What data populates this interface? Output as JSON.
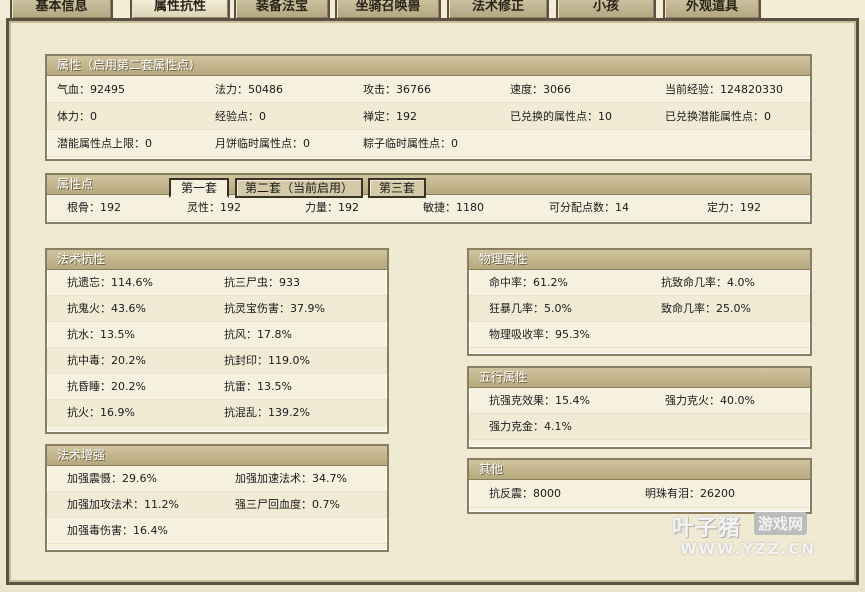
{
  "tabs": [
    "基本信息",
    "属性抗性",
    "装备法宝",
    "坐骑召唤兽",
    "法术修正",
    "小孩",
    "外观道具"
  ],
  "active_tab": "属性抗性",
  "attributes": {
    "title": "属性（启用第二套属性点）",
    "rows": [
      [
        {
          "l": "气血：",
          "v": "92495"
        },
        {
          "l": "法力：",
          "v": "50486"
        },
        {
          "l": "攻击：",
          "v": "36766"
        },
        {
          "l": "速度：",
          "v": "3066"
        },
        {
          "l": "当前经验：",
          "v": "124820330"
        }
      ],
      [
        {
          "l": "体力：",
          "v": "0"
        },
        {
          "l": "经验点：",
          "v": "0"
        },
        {
          "l": "禅定：",
          "v": "192"
        },
        {
          "l": "已兑换的属性点：",
          "v": "10"
        },
        {
          "l": "已兑换潜能属性点：",
          "v": "0"
        }
      ],
      [
        {
          "l": "潜能属性点上限：",
          "v": "0"
        },
        {
          "l": "月饼临时属性点：",
          "v": "0"
        },
        {
          "l": "粽子临时属性点：",
          "v": "0"
        }
      ]
    ]
  },
  "points": {
    "title": "属性点",
    "subtabs": [
      "第一套",
      "第二套（当前启用）",
      "第三套"
    ],
    "active_subtab": "第一套",
    "items": [
      {
        "l": "根骨：",
        "v": "192"
      },
      {
        "l": "灵性：",
        "v": "192"
      },
      {
        "l": "力量：",
        "v": "192"
      },
      {
        "l": "敏捷：",
        "v": "1180"
      },
      {
        "l": "可分配点数：",
        "v": "14"
      },
      {
        "l": "定力：",
        "v": "192"
      }
    ]
  },
  "magic_resist": {
    "title": "法术抗性",
    "rows": [
      [
        {
          "l": "抗遗忘：",
          "v": "114.6%"
        },
        {
          "l": "抗三尸虫：",
          "v": "933"
        }
      ],
      [
        {
          "l": "抗鬼火：",
          "v": "43.6%"
        },
        {
          "l": "抗灵宝伤害：",
          "v": "37.9%"
        }
      ],
      [
        {
          "l": "抗水：",
          "v": "13.5%"
        },
        {
          "l": "抗风：",
          "v": "17.8%"
        }
      ],
      [
        {
          "l": "抗中毒：",
          "v": "20.2%"
        },
        {
          "l": "抗封印：",
          "v": "119.0%"
        }
      ],
      [
        {
          "l": "抗昏睡：",
          "v": "20.2%"
        },
        {
          "l": "抗雷：",
          "v": "13.5%"
        }
      ],
      [
        {
          "l": "抗火：",
          "v": "16.9%"
        },
        {
          "l": "抗混乱：",
          "v": "139.2%"
        }
      ]
    ]
  },
  "magic_boost": {
    "title": "法术增强",
    "rows": [
      [
        {
          "l": "加强震慑：",
          "v": "29.6%"
        },
        {
          "l": "加强加速法术：",
          "v": "34.7%"
        }
      ],
      [
        {
          "l": "加强加攻法术：",
          "v": "11.2%"
        },
        {
          "l": "强三尸回血度：",
          "v": "0.7%"
        }
      ],
      [
        {
          "l": "加强毒伤害：",
          "v": "16.4%"
        }
      ]
    ]
  },
  "physical": {
    "title": "物理属性",
    "rows": [
      [
        {
          "l": "命中率：",
          "v": "61.2%"
        },
        {
          "l": "抗致命几率：",
          "v": "4.0%"
        }
      ],
      [
        {
          "l": "狂暴几率：",
          "v": "5.0%"
        },
        {
          "l": "致命几率：",
          "v": "25.0%"
        }
      ],
      [
        {
          "l": "物理吸收率：",
          "v": "95.3%"
        }
      ]
    ]
  },
  "elements": {
    "title": "五行属性",
    "rows": [
      [
        {
          "l": "抗强克效果：",
          "v": "15.4%"
        },
        {
          "l": "强力克火：",
          "v": "40.0%"
        }
      ],
      [
        {
          "l": "强力克金：",
          "v": "4.1%"
        }
      ]
    ]
  },
  "other": {
    "title": "其他",
    "rows": [
      [
        {
          "l": "抗反震：",
          "v": "8000"
        },
        {
          "l": "明珠有泪：",
          "v": "26200"
        }
      ]
    ]
  },
  "watermark": {
    "brand": "叶子猪",
    "tag": "游戏网",
    "url": "WWW.YZZ.CN"
  }
}
